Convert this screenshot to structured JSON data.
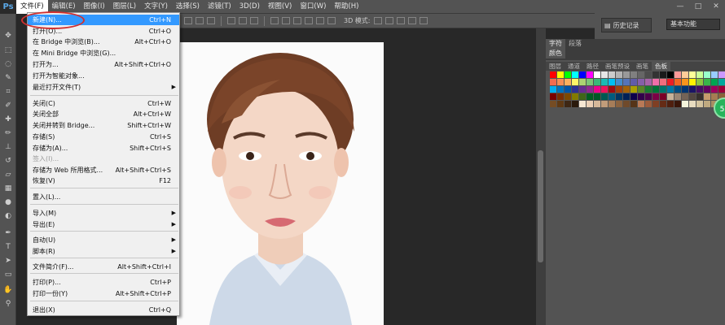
{
  "app": {
    "logo": "Ps"
  },
  "menubar": {
    "items": [
      "文件(F)",
      "编辑(E)",
      "图像(I)",
      "图层(L)",
      "文字(Y)",
      "选择(S)",
      "滤镜(T)",
      "3D(D)",
      "视图(V)",
      "窗口(W)",
      "帮助(H)"
    ]
  },
  "options_bar": {
    "mode_label": "3D 模式:"
  },
  "right_top": {
    "history_label": "历史记录",
    "workspace": "基本功能",
    "window_controls": [
      "—",
      "□",
      "✕"
    ]
  },
  "panels": {
    "tabs_row1": [
      "字符",
      "段落"
    ],
    "tabs_row2": [
      "颜色"
    ],
    "tabs_row3": [
      "图层",
      "通道",
      "路径",
      "画笔预设",
      "画笔",
      "色板"
    ],
    "badge": "5L"
  },
  "file_menu": {
    "items": [
      {
        "label": "新建(N)...",
        "shortcut": "Ctrl+N",
        "highlight": true
      },
      {
        "label": "打开(O)...",
        "shortcut": "Ctrl+O"
      },
      {
        "label": "在 Bridge 中浏览(B)...",
        "shortcut": "Alt+Ctrl+O"
      },
      {
        "label": "在 Mini Bridge 中浏览(G)...",
        "shortcut": ""
      },
      {
        "label": "打开为...",
        "shortcut": "Alt+Shift+Ctrl+O"
      },
      {
        "label": "打开为智能对象...",
        "shortcut": ""
      },
      {
        "label": "最近打开文件(T)",
        "shortcut": "",
        "submenu": true
      },
      {
        "label": "关闭(C)",
        "shortcut": "Ctrl+W"
      },
      {
        "label": "关闭全部",
        "shortcut": "Alt+Ctrl+W"
      },
      {
        "label": "关闭并转到 Bridge...",
        "shortcut": "Shift+Ctrl+W"
      },
      {
        "label": "存储(S)",
        "shortcut": "Ctrl+S"
      },
      {
        "label": "存储为(A)...",
        "shortcut": "Shift+Ctrl+S"
      },
      {
        "label": "签入(I)...",
        "shortcut": "",
        "disabled": true
      },
      {
        "label": "存储为 Web 所用格式...",
        "shortcut": "Alt+Shift+Ctrl+S"
      },
      {
        "label": "恢复(V)",
        "shortcut": "F12"
      },
      {
        "label": "置入(L)...",
        "shortcut": ""
      },
      {
        "label": "导入(M)",
        "shortcut": "",
        "submenu": true
      },
      {
        "label": "导出(E)",
        "shortcut": "",
        "submenu": true
      },
      {
        "label": "自动(U)",
        "shortcut": "",
        "submenu": true
      },
      {
        "label": "脚本(R)",
        "shortcut": "",
        "submenu": true
      },
      {
        "label": "文件简介(F)...",
        "shortcut": "Alt+Shift+Ctrl+I"
      },
      {
        "label": "打印(P)...",
        "shortcut": "Ctrl+P"
      },
      {
        "label": "打印一份(Y)",
        "shortcut": "Alt+Shift+Ctrl+P"
      },
      {
        "label": "退出(X)",
        "shortcut": "Ctrl+Q"
      }
    ]
  },
  "colors": {
    "highlight": "#3399ff",
    "annotation": "#d23030",
    "swatches": [
      "#ff0000",
      "#ffff00",
      "#00ff00",
      "#00ffff",
      "#0000ff",
      "#ff00ff",
      "#ffffff",
      "#e6e6e6",
      "#cccccc",
      "#b3b3b3",
      "#999999",
      "#808080",
      "#666666",
      "#4d4d4d",
      "#333333",
      "#1a1a1a",
      "#000000",
      "#ff9999",
      "#ffcc99",
      "#ffff99",
      "#ccff99",
      "#99ffcc",
      "#99ccff",
      "#cc99ff",
      "#f26c4f",
      "#f68e55",
      "#fbaf5d",
      "#fff467",
      "#acd372",
      "#7cc576",
      "#3bb878",
      "#1abbb4",
      "#00bff3",
      "#438ccb",
      "#5574b9",
      "#605ca8",
      "#855fa8",
      "#a763a8",
      "#f06ea9",
      "#f26d7d",
      "#ed1c24",
      "#f26522",
      "#f7941d",
      "#fff200",
      "#8dc63f",
      "#39b54a",
      "#00a651",
      "#00a99d",
      "#00aeef",
      "#0072bc",
      "#0054a6",
      "#2e3192",
      "#662d91",
      "#92278f",
      "#ec008c",
      "#ed145b",
      "#9e0b0f",
      "#a0410d",
      "#a3620a",
      "#aba000",
      "#598527",
      "#1a7b30",
      "#007236",
      "#00746b",
      "#0076a3",
      "#004b80",
      "#003471",
      "#1b1464",
      "#440e62",
      "#630460",
      "#9e005d",
      "#9e0039",
      "#790000",
      "#7b2e00",
      "#7d4900",
      "#827b00",
      "#406618",
      "#005e20",
      "#005826",
      "#005952",
      "#005b7f",
      "#003663",
      "#002157",
      "#0d004c",
      "#32004b",
      "#4b0049",
      "#7b0046",
      "#7a0026",
      "#c7b299",
      "#998675",
      "#736357",
      "#534741",
      "#37302d",
      "#c69c6d",
      "#a67c52",
      "#8c6239",
      "#754c24",
      "#603913",
      "#3e2714",
      "#2b1a0c",
      "#f7e7d3",
      "#ecd0b6",
      "#d6b89a",
      "#c19c7a",
      "#a67d59",
      "#8a623f",
      "#704a2b",
      "#563418",
      "#b97a57",
      "#9c5b3b",
      "#7f3f24",
      "#652b15",
      "#4f1f0e",
      "#3a1609",
      "#f5f5dc",
      "#e8dcc0",
      "#d4c4a0",
      "#bfa980",
      "#a98f63",
      "#917449"
    ]
  }
}
